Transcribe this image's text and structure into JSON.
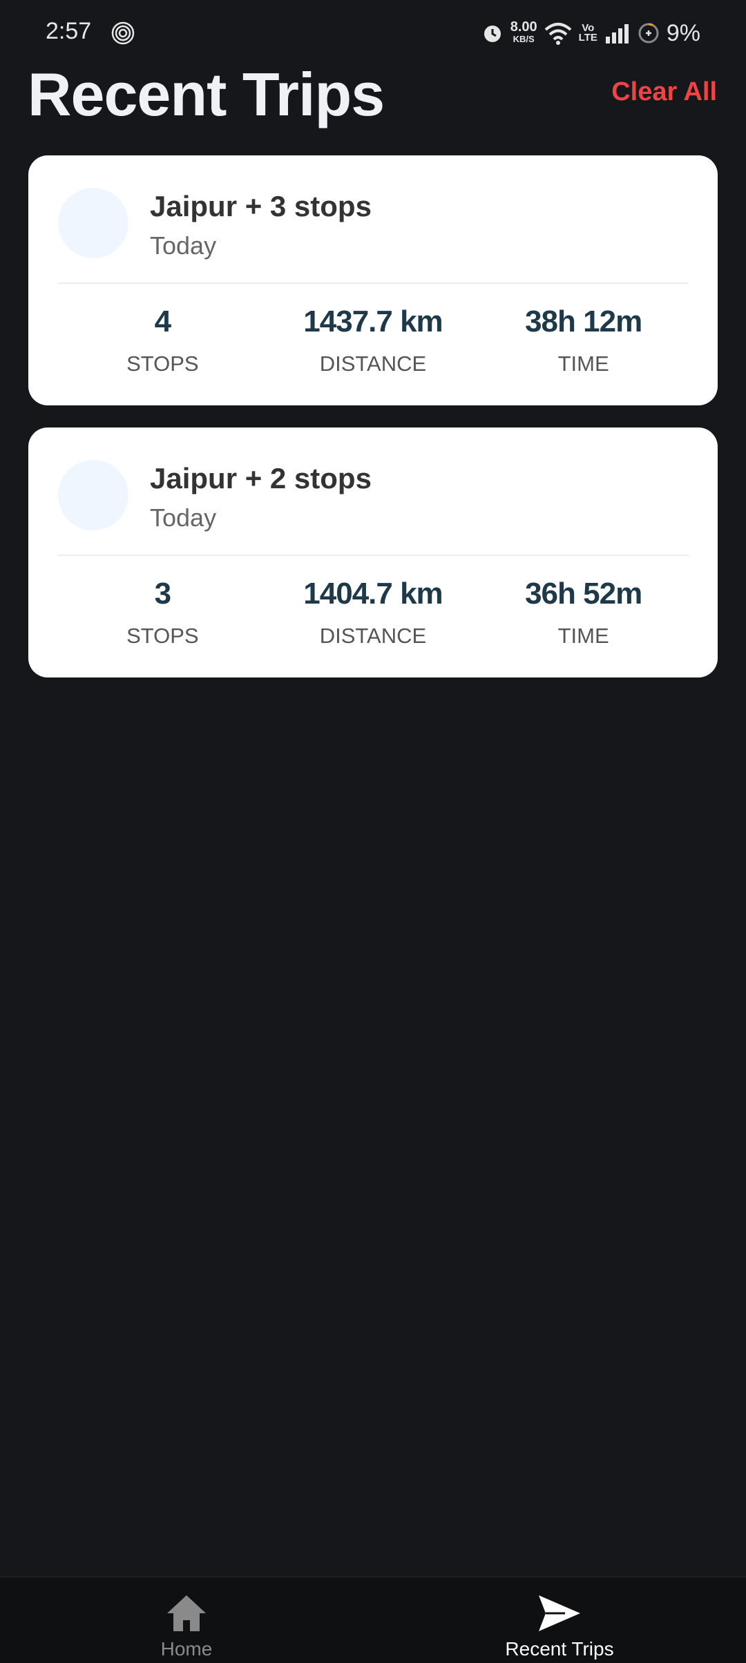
{
  "status_bar": {
    "time": "2:57",
    "net_speed": "8.00",
    "net_unit": "KB/S",
    "volte_top": "Vo",
    "volte_bottom": "LTE",
    "battery": "9%"
  },
  "header": {
    "title": "Recent Trips",
    "clear_label": "Clear All"
  },
  "colors": {
    "background": "#15171a",
    "accent_red": "#ef4444",
    "card": "#ffffff",
    "stat_value": "#1e3a4a"
  },
  "trips": [
    {
      "title": "Jaipur + 3 stops",
      "date": "Today",
      "stats": [
        {
          "value": "4",
          "label": "STOPS"
        },
        {
          "value": "1437.7 km",
          "label": "DISTANCE"
        },
        {
          "value": "38h 12m",
          "label": "TIME"
        }
      ]
    },
    {
      "title": "Jaipur + 2 stops",
      "date": "Today",
      "stats": [
        {
          "value": "3",
          "label": "STOPS"
        },
        {
          "value": "1404.7 km",
          "label": "DISTANCE"
        },
        {
          "value": "36h 52m",
          "label": "TIME"
        }
      ]
    }
  ],
  "bottom_nav": {
    "items": [
      {
        "label": "Home",
        "icon": "home-icon"
      },
      {
        "label": "Recent Trips",
        "icon": "send-icon"
      }
    ]
  }
}
